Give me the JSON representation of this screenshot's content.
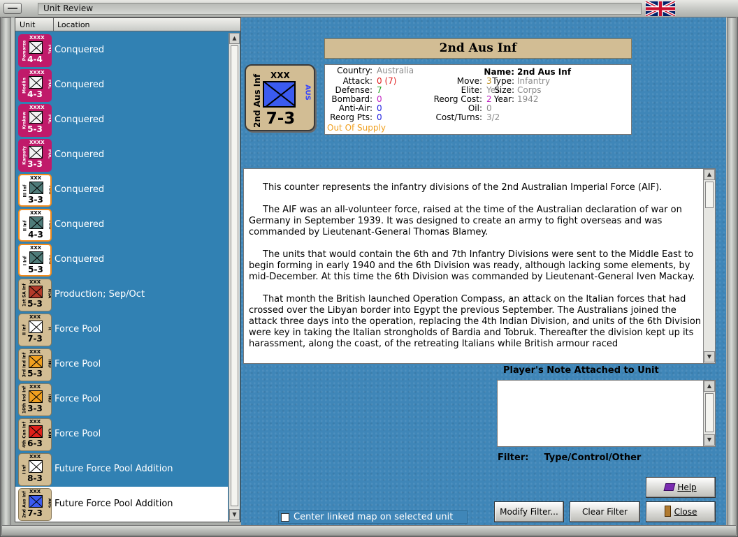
{
  "window": {
    "title": "Unit Review"
  },
  "list": {
    "headers": {
      "unit": "Unit",
      "location": "Location"
    },
    "rows": [
      {
        "size": "XXXX",
        "name": "Pomorze",
        "nation": "POL",
        "strength": "4-4",
        "location": "Conquered",
        "bg": "#c01a6a",
        "box": "#f4f4f4",
        "fg": "#ffffff",
        "border": "#c01a6a",
        "selected": false
      },
      {
        "size": "XXXX",
        "name": "Modlin",
        "nation": "POL",
        "strength": "4-3",
        "location": "Conquered",
        "bg": "#c01a6a",
        "box": "#f4f4f4",
        "fg": "#ffffff",
        "border": "#c01a6a",
        "selected": false
      },
      {
        "size": "XXXX",
        "name": "Krakow",
        "nation": "POL",
        "strength": "5-3",
        "location": "Conquered",
        "bg": "#c01a6a",
        "box": "#f4f4f4",
        "fg": "#ffffff",
        "border": "#c01a6a",
        "selected": false
      },
      {
        "size": "XXXX",
        "name": "Karpaty",
        "nation": "POL",
        "strength": "3-3",
        "location": "Conquered",
        "bg": "#c01a6a",
        "box": "#f4f4f4",
        "fg": "#ffffff",
        "border": "#c01a6a",
        "selected": false
      },
      {
        "size": "XXX",
        "name": "III Inf",
        "nation": "YUG",
        "strength": "3-3",
        "location": "Conquered",
        "bg": "#ffffff",
        "box": "#4f7c7a",
        "fg": "#000000",
        "border": "#f28a1a",
        "selected": false
      },
      {
        "size": "XXX",
        "name": "II Inf",
        "nation": "YUG",
        "strength": "4-3",
        "location": "Conquered",
        "bg": "#ffffff",
        "box": "#4f7c7a",
        "fg": "#000000",
        "border": "#f28a1a",
        "selected": false
      },
      {
        "size": "XXX",
        "name": "I Inf",
        "nation": "YUG",
        "strength": "5-3",
        "location": "Conquered",
        "bg": "#ffffff",
        "box": "#4f7c7a",
        "fg": "#000000",
        "border": "#f28a1a",
        "selected": false
      },
      {
        "size": "XXX",
        "name": "1st SA Inf",
        "nation": "RSA",
        "strength": "5-3",
        "location": "Production; Sep/Oct",
        "bg": "#d2bd94",
        "box": "#b33a2a",
        "fg": "#000000",
        "border": "#8a7a5a",
        "selected": false
      },
      {
        "size": "XXX",
        "name": "II Inf",
        "nation": "R",
        "strength": "7-3",
        "location": "Force Pool",
        "bg": "#d2bd94",
        "box": "#ffffff",
        "fg": "#000000",
        "border": "#8a7a5a",
        "selected": false
      },
      {
        "size": "XXX",
        "name": "3rd Ind Inf",
        "nation": "IND",
        "strength": "5-3",
        "location": "Force Pool",
        "bg": "#d2bd94",
        "box": "#f0a020",
        "fg": "#000000",
        "border": "#8a7a5a",
        "selected": false
      },
      {
        "size": "XXX",
        "name": "16th Ind Inf",
        "nation": "IND",
        "strength": "3-3",
        "location": "Force Pool",
        "bg": "#d2bd94",
        "box": "#f0a020",
        "fg": "#000000",
        "border": "#8a7a5a",
        "selected": false
      },
      {
        "size": "XXX",
        "name": "4th Can Inf",
        "nation": "CAN",
        "strength": "6-3",
        "location": "Force Pool",
        "bg": "#d2bd94",
        "box": "#e0201a",
        "fg": "#000000",
        "border": "#8a7a5a",
        "selected": false
      },
      {
        "size": "XXX",
        "name": "I Inf",
        "nation": "",
        "strength": "8-3",
        "location": "Future Force Pool Addition",
        "bg": "#d2bd94",
        "box": "#ffffff",
        "fg": "#000000",
        "border": "#8a7a5a",
        "selected": false
      },
      {
        "size": "XXX",
        "name": "2nd Aus Inf",
        "nation": "AUS",
        "strength": "7-3",
        "location": "Future Force Pool Addition",
        "bg": "#d2bd94",
        "box": "#3b5bf0",
        "fg": "#000000",
        "border": "#8a7a5a",
        "selected": true
      }
    ]
  },
  "unit": {
    "title": "2nd Aus Inf",
    "counter": {
      "size": "XXX",
      "name": "2nd Aus Inf",
      "nation": "AUS",
      "strength": "7-3"
    },
    "stats": {
      "country_label": "Country:",
      "country": "Australia",
      "attack_label": "Attack:",
      "attack": "0 (7)",
      "defense_label": "Defense:",
      "defense": "7",
      "bombard_label": "Bombard:",
      "bombard": "0",
      "antiair_label": "Anti-Air:",
      "antiair": "0",
      "reorgpts_label": "Reorg Pts:",
      "reorgpts": "0",
      "supply": "Out Of Supply",
      "move_label": "Move:",
      "move": "3",
      "elite_label": "Elite:",
      "elite": "Yes",
      "reorgcost_label": "Reorg Cost:",
      "reorgcost": "2",
      "oil_label": "Oil:",
      "oil": "0",
      "costturns_label": "Cost/Turns:",
      "costturns": "3/2",
      "name_label": "Name:",
      "name": "2nd Aus Inf",
      "type_label": "Type:",
      "type": "Infantry",
      "size_label": "Size:",
      "size": "Corps",
      "year_label": "Year:",
      "year": "1942"
    },
    "description": [
      "This counter represents the infantry divisions of the 2nd Australian Imperial Force (AIF).",
      "The AIF was an all-volunteer force, raised at the time of the Australian declaration of war on Germany in September 1939.  It was designed to create an army to fight overseas and was commanded by Lieutenant-General Thomas Blamey.",
      "The units that would contain the 6th and 7th Infantry Divisions were sent to the Middle East to begin forming in early 1940 and the 6th Division was ready, although lacking some elements, by mid-December.  At this time the 6th Division was commanded by Lieutenant-General Iven Mackay.",
      "That month the British launched Operation Compass, an attack on the Italian forces that had crossed over the Libyan border into Egypt the previous September.  The Australians joined the attack three days into the operation, replacing the 4th Indian Division, and units of the 6th Division were key in taking the Italian strongholds of Bardia and Tobruk.  Thereafter the division kept up its harassment, along the coast, of the retreating Italians while British armour raced"
    ],
    "note_label": "Player's Note Attached to Unit",
    "note_text": ""
  },
  "filter": {
    "label": "Filter:",
    "value": "Type/Control/Other"
  },
  "buttons": {
    "help": "Help",
    "modify_filter": "Modify Filter...",
    "clear_filter": "Clear Filter",
    "close": "Close"
  },
  "center_map": {
    "label": "Center linked map on selected unit",
    "checked": false
  },
  "colors": {
    "panel_blue": "#3181b3",
    "main_blue": "#3f86b8",
    "tan": "#d2bd94",
    "orange_text": "#f0a020",
    "red_text": "#e02020",
    "green_text": "#20a020",
    "purple_text": "#c020c0",
    "blue_text": "#2020e0",
    "grey_text": "#8c8c8c"
  }
}
